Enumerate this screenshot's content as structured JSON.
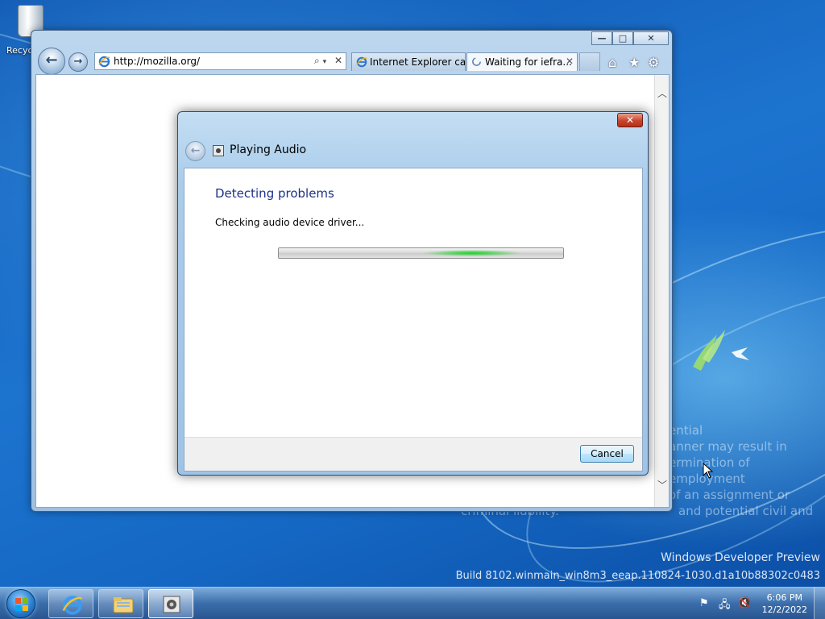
{
  "desktop": {
    "recycle_bin_label": "Recyc",
    "watermark_lines": [
      "ential",
      "anner may result in",
      "ermination of employment",
      "of an assignment or",
      "and potential civil and",
      "criminal liability."
    ],
    "build_line1": "Windows Developer Preview",
    "build_line2": "Build 8102.winmain_win8m3_eeap.110824-1030.d1a10b88302c0483"
  },
  "browser": {
    "address_url": "http://mozilla.org/",
    "tabs": [
      {
        "label": "Internet Explorer ca...",
        "icon": "ie-icon",
        "active": false
      },
      {
        "label": "Waiting for iefra...",
        "icon": "loading-icon",
        "active": true
      }
    ],
    "caption": {
      "minimize": "—",
      "maximize": "□",
      "close": "✕"
    },
    "toolbar_icons": [
      "home-icon",
      "favorites-icon",
      "tools-icon"
    ]
  },
  "dialog": {
    "title": "Playing Audio",
    "heading": "Detecting problems",
    "status": "Checking audio device driver...",
    "cancel_label": "Cancel",
    "close_glyph": "✕",
    "progress": {
      "mode": "indeterminate",
      "glow_position_fraction": 0.68,
      "color": "#1fcf2a"
    }
  },
  "taskbar": {
    "pinned": [
      "internet-explorer",
      "windows-explorer",
      "playing-audio-troubleshooter"
    ],
    "active_item": "playing-audio-troubleshooter",
    "clock_time": "6:06 PM",
    "clock_date": "12/2/2022",
    "tray_icons": [
      "action-center-flag-icon",
      "network-icon",
      "volume-muted-icon"
    ]
  },
  "colors": {
    "dialog_heading": "#1e3287",
    "accent_glass": "#a9cceb",
    "desktop_blue": "#1569c5"
  }
}
